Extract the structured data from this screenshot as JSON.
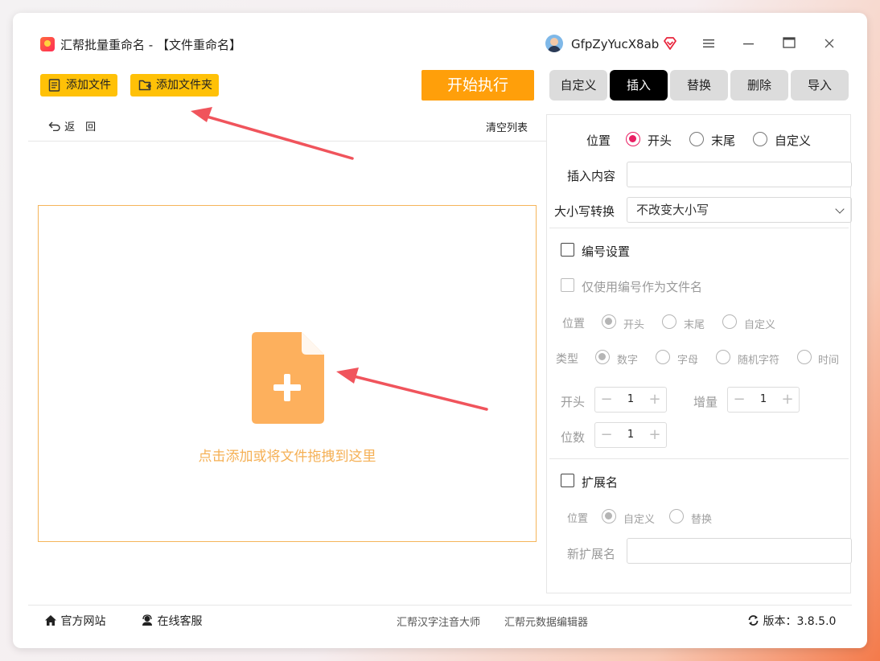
{
  "titlebar": {
    "title": "汇帮批量重命名 - 【文件重命名】",
    "username": "GfpZyYucX8ab",
    "menu_icon": "hamburger-icon",
    "minimize_icon": "minimize-icon",
    "maximize_icon": "maximize-icon",
    "close_icon": "close-icon"
  },
  "toolbar": {
    "add_file": "添加文件",
    "add_folder": "添加文件夹",
    "start": "开始执行"
  },
  "tabs": [
    {
      "label": "自定义",
      "active": false
    },
    {
      "label": "插入",
      "active": true
    },
    {
      "label": "替换",
      "active": false
    },
    {
      "label": "删除",
      "active": false
    },
    {
      "label": "导入",
      "active": false
    }
  ],
  "list": {
    "back": "返　回",
    "clear": "清空列表",
    "drop_text": "点击添加或将文件拖拽到这里"
  },
  "insert": {
    "position_label": "位置",
    "position_options": [
      "开头",
      "末尾",
      "自定义"
    ],
    "position_selected": "开头",
    "content_label": "插入内容",
    "content_value": "",
    "case_label": "大小写转换",
    "case_value": "不改变大小写"
  },
  "numbering": {
    "label": "编号设置",
    "only_number_label": "仅使用编号作为文件名",
    "position_label": "位置",
    "position_options": [
      "开头",
      "末尾",
      "自定义"
    ],
    "type_label": "类型",
    "type_options": [
      "数字",
      "字母",
      "随机字符",
      "时间"
    ],
    "start_label": "开头",
    "start_value": "1",
    "increment_label": "增量",
    "increment_value": "1",
    "digits_label": "位数",
    "digits_value": "1",
    "minus": "−",
    "plus": "+"
  },
  "extension": {
    "label": "扩展名",
    "position_label": "位置",
    "position_options": [
      "自定义",
      "替换"
    ],
    "new_ext_label": "新扩展名",
    "new_ext_value": ""
  },
  "footer": {
    "website": "官方网站",
    "support": "在线客服",
    "link1": "汇帮汉字注音大师",
    "link2": "汇帮元数据编辑器",
    "version": "版本：3.8.5.0"
  },
  "colors": {
    "accent_orange": "#ff9f0a",
    "button_yellow": "#ffc107",
    "radio_checked": "#e91e63",
    "drop_orange": "#f5b055"
  }
}
